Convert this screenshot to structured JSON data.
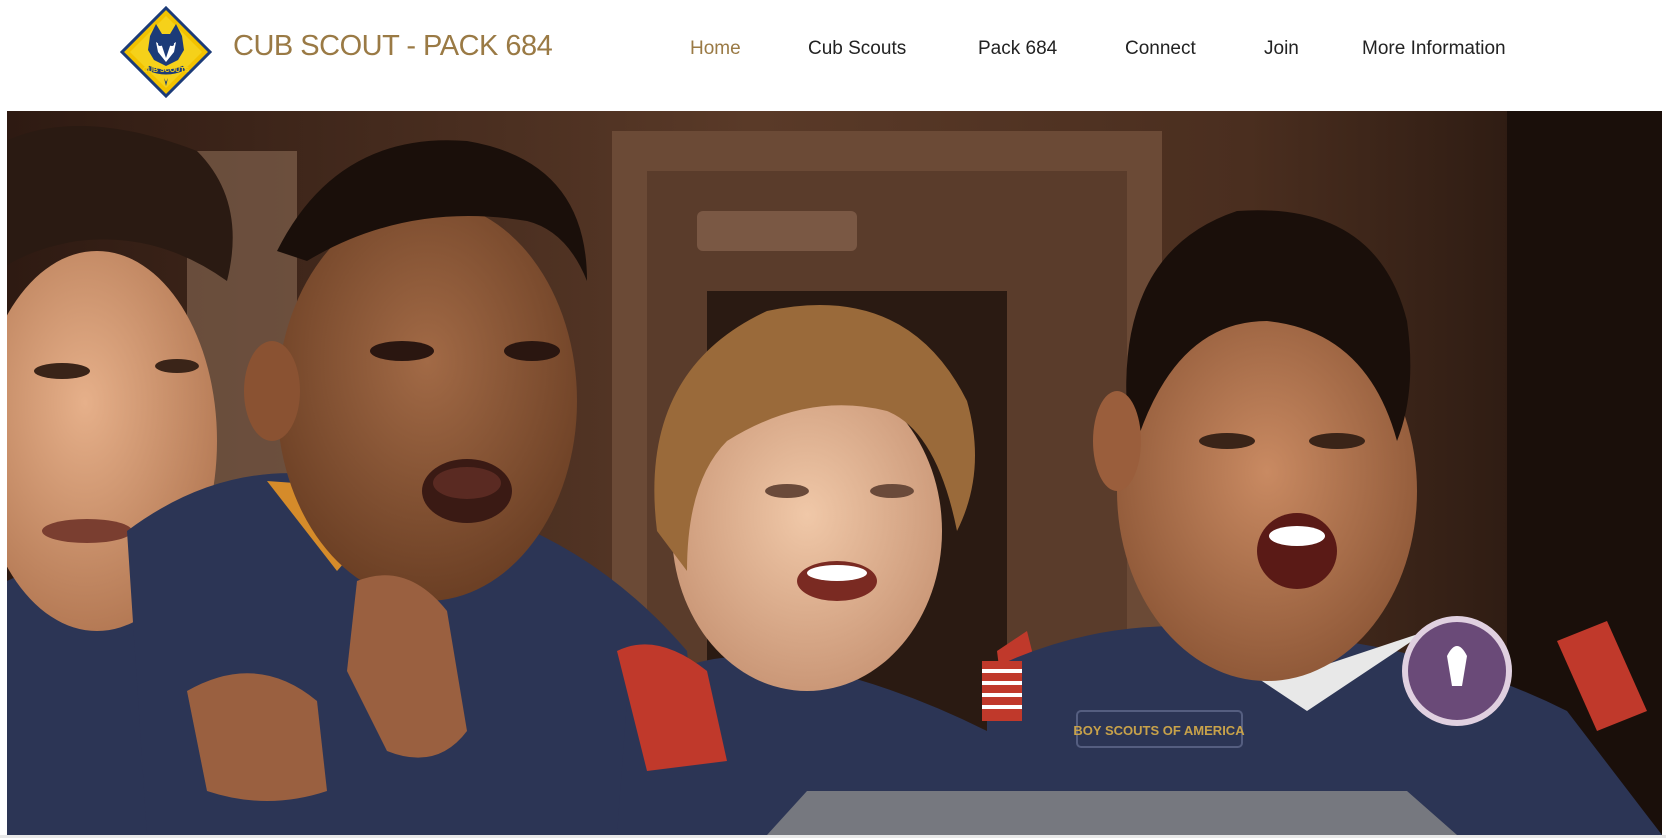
{
  "header": {
    "logo_icon": "cub-scouts-wolf-logo-icon",
    "logo_text": "CUB SCOUTS",
    "site_title": "CUB SCOUT - PACK 684",
    "brand_color": "#9a7a45"
  },
  "nav": {
    "items": [
      {
        "label": "Home",
        "active": true
      },
      {
        "label": "Cub Scouts",
        "active": false
      },
      {
        "label": "Pack 684",
        "active": false
      },
      {
        "label": "Connect",
        "active": false
      },
      {
        "label": "Join",
        "active": false
      },
      {
        "label": "More Information",
        "active": false
      }
    ]
  },
  "hero": {
    "image": "photo of four cub scouts in blue uniforms looking excitedly at something",
    "badge_text": "BOY SCOUTS OF AMERICA"
  },
  "colors": {
    "uniform_blue": "#2c3555",
    "skin_light": "#d9a27c",
    "skin_dark": "#8a5636",
    "background_wood": "#4a2e1f"
  }
}
